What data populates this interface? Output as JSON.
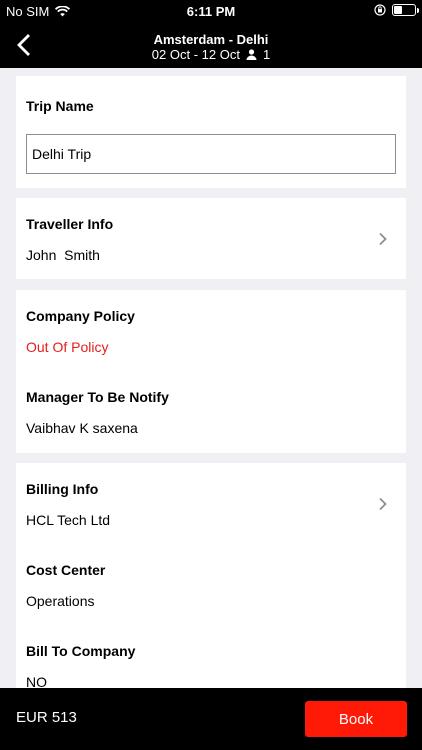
{
  "status_bar": {
    "carrier": "No SIM",
    "time": "6:11 PM",
    "battery_level": 0.4
  },
  "header": {
    "route": "Amsterdam - Delhi",
    "dates": "02 Oct - 12 Oct",
    "traveller_count": "1"
  },
  "trip": {
    "label": "Trip Name",
    "value": "Delhi Trip"
  },
  "traveller": {
    "label": "Traveller Info",
    "value": "John  Smith"
  },
  "policy": {
    "label": "Company Policy",
    "value": "Out Of Policy",
    "manager_label": "Manager To Be Notify",
    "manager_value": "Vaibhav K saxena"
  },
  "billing": {
    "label": "Billing Info",
    "value": "HCL Tech Ltd",
    "cost_center_label": "Cost Center",
    "cost_center_value": "Operations",
    "bill_to_label": "Bill To Company",
    "bill_to_value": "NO"
  },
  "footer": {
    "total": "EUR 513",
    "book_label": "Book"
  },
  "colors": {
    "accent": "#ff1a08",
    "policy_red": "#e41e1e"
  }
}
